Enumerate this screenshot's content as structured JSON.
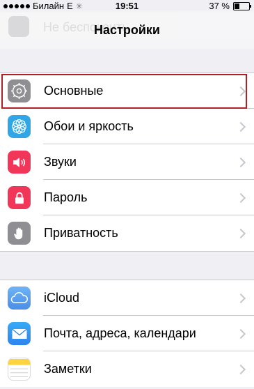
{
  "status_bar": {
    "carrier": "Билайн",
    "network": "E",
    "time": "19:51",
    "battery_text": "37 %",
    "battery_level": 0.37
  },
  "background_row": {
    "label": "Не беспокоить"
  },
  "nav": {
    "title": "Настройки"
  },
  "groups": [
    [
      {
        "id": "general",
        "label": "Основные",
        "icon": "gear-icon",
        "color": "#8e8e93"
      },
      {
        "id": "wallpaper",
        "label": "Обои и яркость",
        "icon": "flower-icon",
        "color": "#30a6e6"
      },
      {
        "id": "sounds",
        "label": "Звуки",
        "icon": "speaker-icon",
        "color": "#f1365a"
      },
      {
        "id": "passcode",
        "label": "Пароль",
        "icon": "lock-icon",
        "color": "#f1365a"
      },
      {
        "id": "privacy",
        "label": "Приватность",
        "icon": "hand-icon",
        "color": "#8e8e93"
      }
    ],
    [
      {
        "id": "icloud",
        "label": "iCloud",
        "icon": "cloud-icon",
        "color": "#4a8ee8"
      },
      {
        "id": "mail",
        "label": "Почта, адреса, календари",
        "icon": "envelope-icon",
        "color": "#2f84ed"
      },
      {
        "id": "notes",
        "label": "Заметки",
        "icon": "notepad-icon",
        "color": "#fdd33f"
      }
    ]
  ],
  "highlight_color": "#b21f25"
}
